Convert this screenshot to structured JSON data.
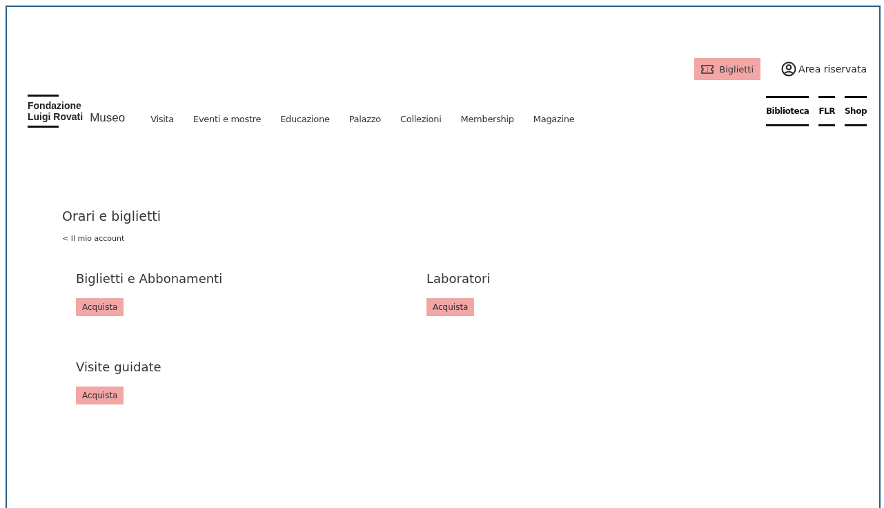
{
  "top_bar": {
    "tickets_button": "Biglietti",
    "account_link": "Area riservata"
  },
  "logo": {
    "name": [
      "Fondazione",
      "Luigi Rovati"
    ],
    "subtitle": "Museo"
  },
  "nav": [
    "Visita",
    "Eventi e mostre",
    "Educazione",
    "Palazzo",
    "Collezioni",
    "Membership",
    "Magazine"
  ],
  "side_links": [
    "Biblioteca",
    "FLR",
    "Shop"
  ],
  "page": {
    "title": "Orari e biglietti",
    "back_link": "< Il mio account"
  },
  "sections": [
    {
      "title": "Biglietti e Abbonamenti",
      "button": "Acquista"
    },
    {
      "title": "Laboratori",
      "button": "Acquista"
    },
    {
      "title": "Visite guidate",
      "button": "Acquista"
    }
  ]
}
